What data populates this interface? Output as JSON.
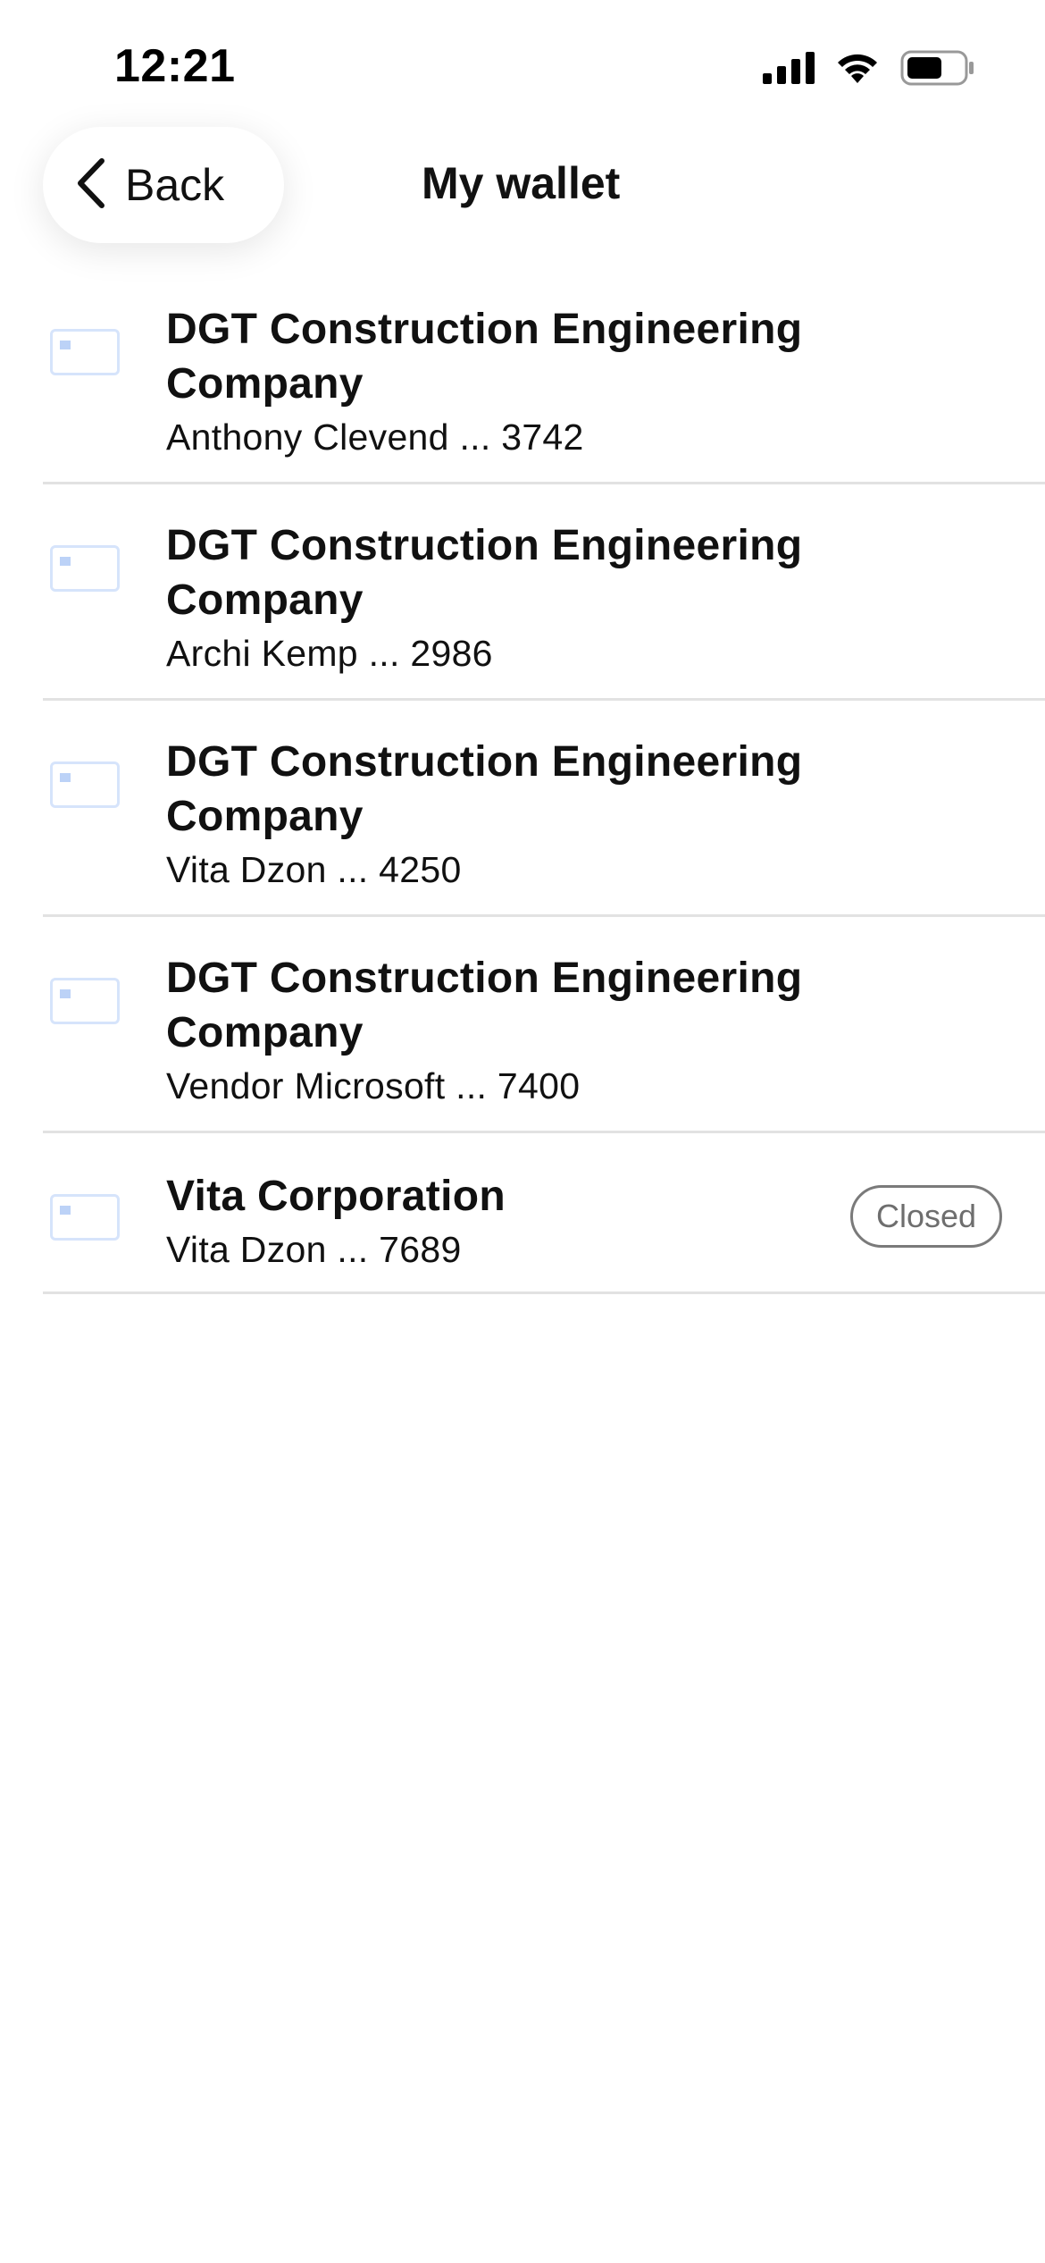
{
  "status_bar": {
    "time": "12:21",
    "icons": [
      "cellular-signal-icon",
      "wifi-icon",
      "battery-icon"
    ]
  },
  "header": {
    "back_label": "Back",
    "title": "My wallet"
  },
  "cards": [
    {
      "company": "DGT Construction Engineering Company",
      "holder": "Anthony Clevend ... 3742",
      "status": ""
    },
    {
      "company": "DGT Construction Engineering Company",
      "holder": "Archi Kemp ... 2986",
      "status": ""
    },
    {
      "company": "DGT Construction Engineering Company",
      "holder": "Vita Dzon ... 4250",
      "status": ""
    },
    {
      "company": "DGT Construction Engineering Company",
      "holder": "Vendor Microsoft ... 7400",
      "status": ""
    },
    {
      "company": "Vita Corporation",
      "holder": "Vita Dzon ... 7689",
      "status": "Closed"
    }
  ],
  "colors": {
    "divider": "#e2e2e2",
    "card_icon_border": "#d6e4fb",
    "badge_border": "#7a7a7a",
    "badge_text": "#6e6e6e"
  }
}
